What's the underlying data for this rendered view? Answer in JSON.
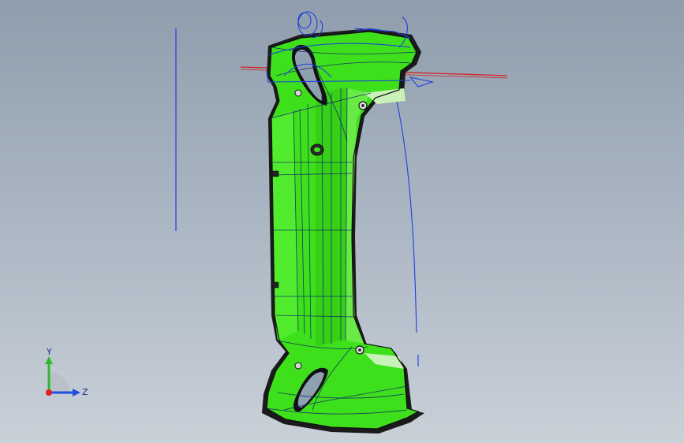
{
  "triad": {
    "y_label": "Y",
    "z_label": "Z"
  },
  "colors": {
    "background_top": "#8f9dac",
    "background_bottom": "#c9d0d8",
    "part_fill": "#3ee01c",
    "part_shadow": "#1f9d10",
    "edge": "#111111",
    "sketch_blue": "#1f3fe0",
    "axis_red": "#d42020",
    "triad_y": "#2fb82f",
    "triad_z": "#1f4fe0",
    "triad_x": "#e02020"
  }
}
